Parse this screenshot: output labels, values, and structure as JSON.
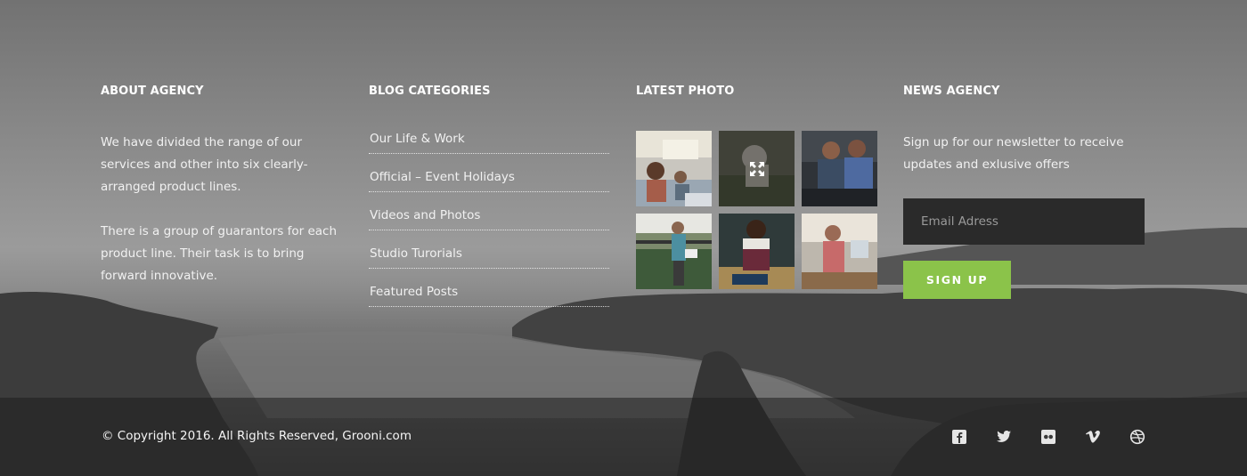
{
  "about": {
    "title": "ABOUT AGENCY",
    "paragraph_1": "We have divided the range of our services and other into six  clearly-arranged product lines.",
    "paragraph_2": "There is a group of guarantors for each product line. Their task is to bring forward innovative."
  },
  "blog": {
    "title": "BLOG CATEGORIES",
    "items": [
      {
        "label": "Our Life & Work"
      },
      {
        "label": "Official  –  Event Holidays"
      },
      {
        "label": "Videos and Photos"
      },
      {
        "label": "Studio Turorials"
      },
      {
        "label": "Featured Posts"
      }
    ]
  },
  "photos": {
    "title": "LATEST PHOTO",
    "hover_icon": "expand-icon"
  },
  "news": {
    "title": "NEWS AGENCY",
    "text": "Sign up for our newsletter to receive updates and exlusive offers",
    "email_placeholder": "Email Adress",
    "signup_label": "SIGN UP"
  },
  "footer": {
    "copyright": "© Copyright 2016. All Rights Reserved, Grooni.com",
    "socials": [
      "facebook-icon",
      "twitter-icon",
      "flickr-icon",
      "vimeo-icon",
      "dribbble-icon"
    ]
  },
  "colors": {
    "accent": "#8bc34a",
    "input_bg": "#2a2a2a",
    "bottom_bar": "#1e1e1e"
  }
}
